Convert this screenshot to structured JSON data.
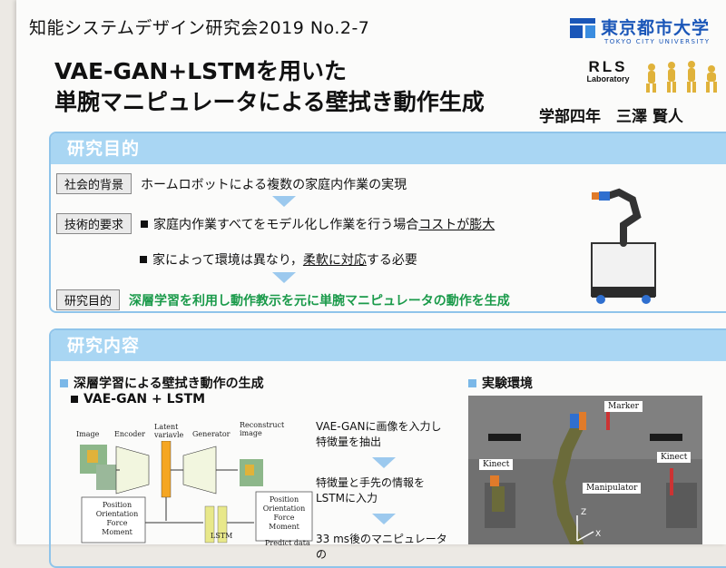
{
  "header": {
    "conference": "知能システムデザイン研究会2019 No.2-7",
    "university_ja": "東京都市大学",
    "university_en": "TOKYO CITY UNIVERSITY",
    "lab_logo_big": "RLS",
    "lab_logo_small": "Laboratory",
    "title_line1": "VAE-GAN+LSTMを用いた",
    "title_line2": "単腕マニピュレータによる壁拭き動作生成",
    "author": "学部四年　三澤 賢人",
    "brand_color": "#1a56b8"
  },
  "purpose": {
    "heading": "研究目的",
    "social_label": "社会的背景",
    "social_text": "ホームロボットによる複数の家庭内作業の実現",
    "tech_label": "技術的要求",
    "tech_text1_pre": "家庭内作業すべてをモデル化し作業を行う場合",
    "tech_text1_u": "コストが膨大",
    "tech_text2_pre": "家によって環境は異なり，",
    "tech_text2_u": "柔軟に対応",
    "tech_text2_post": "する必要",
    "goal_label": "研究目的",
    "goal_text": "深層学習を利用し動作教示を元に単腕マニピュレータの動作を生成",
    "accent_color": "#1a9a4a"
  },
  "content": {
    "heading": "研究内容",
    "sub1": "深層学習による壁拭き動作の生成",
    "sub1_item": "VAE-GAN + LSTM",
    "sub2": "実験環境",
    "diagram": {
      "image": "Image",
      "encoder": "Encoder",
      "latent1": "Latent",
      "latent2": "variavle",
      "generator": "Generator",
      "recon1": "Reconstruct",
      "recon2": "image",
      "pos": "Position",
      "ori": "Orientation",
      "force": "Force",
      "moment": "Moment",
      "lstm": "LSTM",
      "predict": "Predict data"
    },
    "flow": {
      "step1a": "VAE-GANに画像を入力し",
      "step1b": "特徴量を抽出",
      "step2a": "特徴量と手先の情報を",
      "step2b": "LSTMに入力",
      "step3": "33 ms後のマニピュレータの"
    },
    "env": {
      "marker": "Marker",
      "kinect_left": "Kinect",
      "kinect_right": "Kinect",
      "manipulator": "Manipulator",
      "axis_x": "X",
      "axis_z": "Z"
    }
  }
}
